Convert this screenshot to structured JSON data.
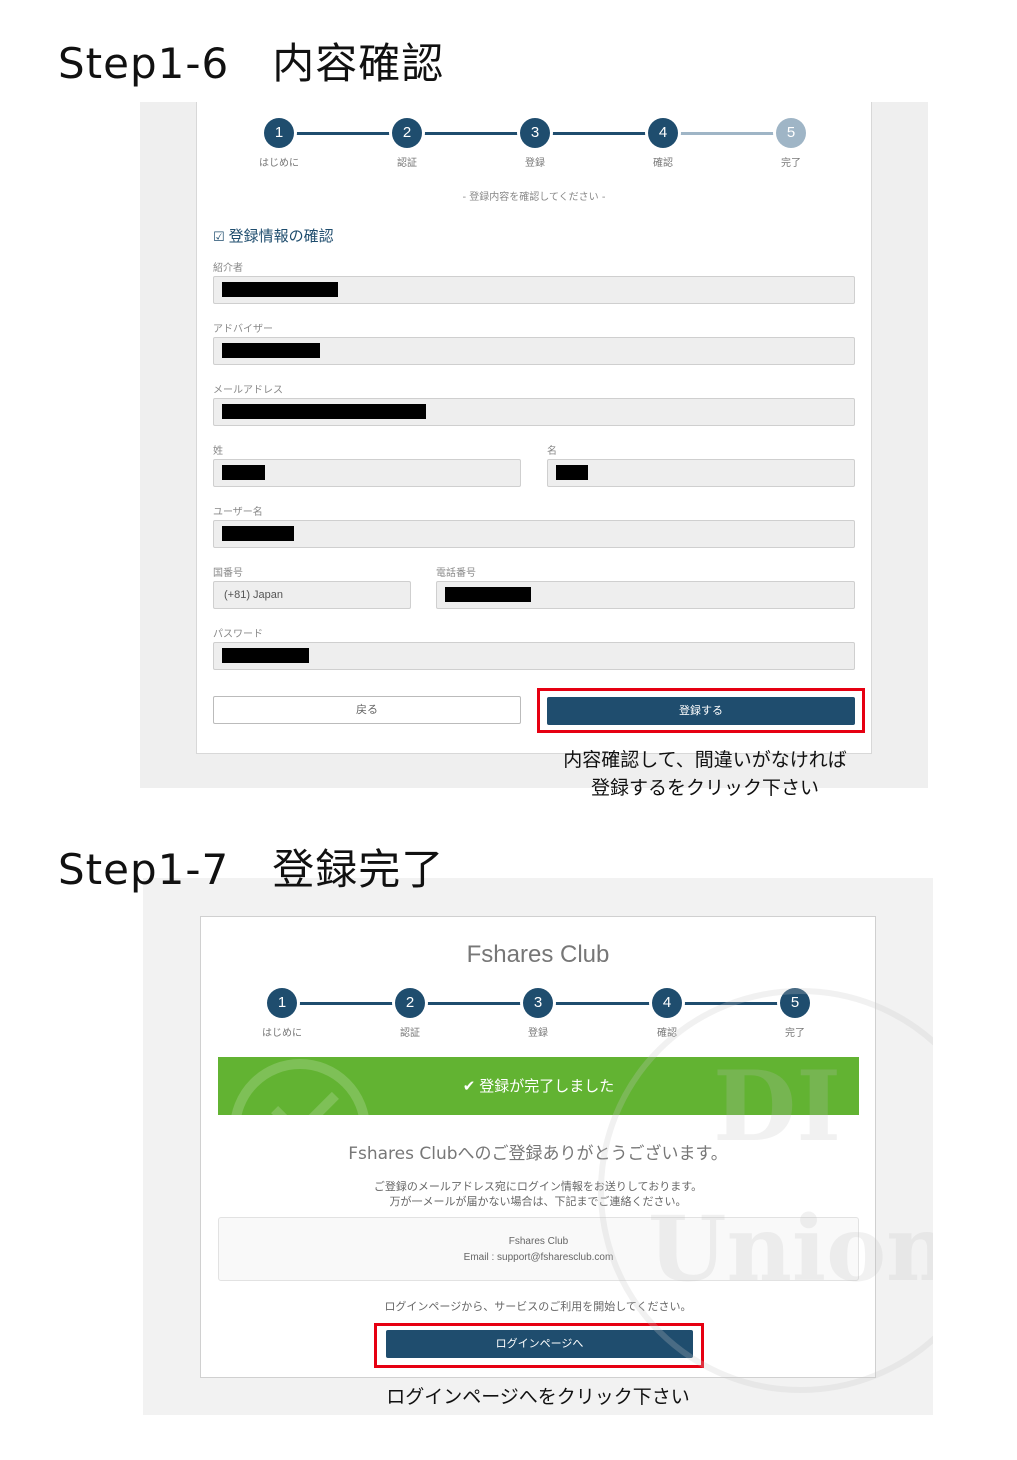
{
  "headings": {
    "step_1_6": "Step1-6　内容確認",
    "step_1_7": "Step1-7　登録完了"
  },
  "stepper": {
    "steps": [
      {
        "num": "1",
        "label": "はじめに"
      },
      {
        "num": "2",
        "label": "認証"
      },
      {
        "num": "3",
        "label": "登録"
      },
      {
        "num": "4",
        "label": "確認"
      },
      {
        "num": "5",
        "label": "完了"
      }
    ]
  },
  "confirm": {
    "note": "- 登録内容を確認してください -",
    "section_title": "登録情報の確認",
    "fields": {
      "referrer": "紹介者",
      "advisor": "アドバイザー",
      "email": "メールアドレス",
      "last_name": "姓",
      "first_name": "名",
      "username": "ユーザー名",
      "country_code": "国番号",
      "country_code_value": "(+81) Japan",
      "phone": "電話番号",
      "password": "パスワード"
    },
    "back_button": "戻る",
    "register_button": "登録する",
    "caption_line1": "内容確認して、間違いがなければ",
    "caption_line2": "登録するをクリック下さい"
  },
  "complete": {
    "brand": "Fshares Club",
    "success_message": "登録が完了しました",
    "thanks": "Fshares Clubへのご登録ありがとうございます。",
    "info_line1": "ご登録のメールアドレス宛にログイン情報をお送りしております。",
    "info_line2": "万が一メールが届かない場合は、下記までご連絡ください。",
    "contact_name": "Fshares Club",
    "contact_email": "Email : support@fsharesclub.com",
    "login_note": "ログインページから、サービスのご利用を開始してください。",
    "login_button": "ログインページへ",
    "caption": "ログインページへをクリック下さい"
  },
  "watermark": {
    "line1": "DI",
    "line2": "Union"
  },
  "colors": {
    "primary": "#1f4d6e",
    "step_inactive": "#9fb5c6",
    "success": "#62b332",
    "highlight": "#e60012"
  }
}
